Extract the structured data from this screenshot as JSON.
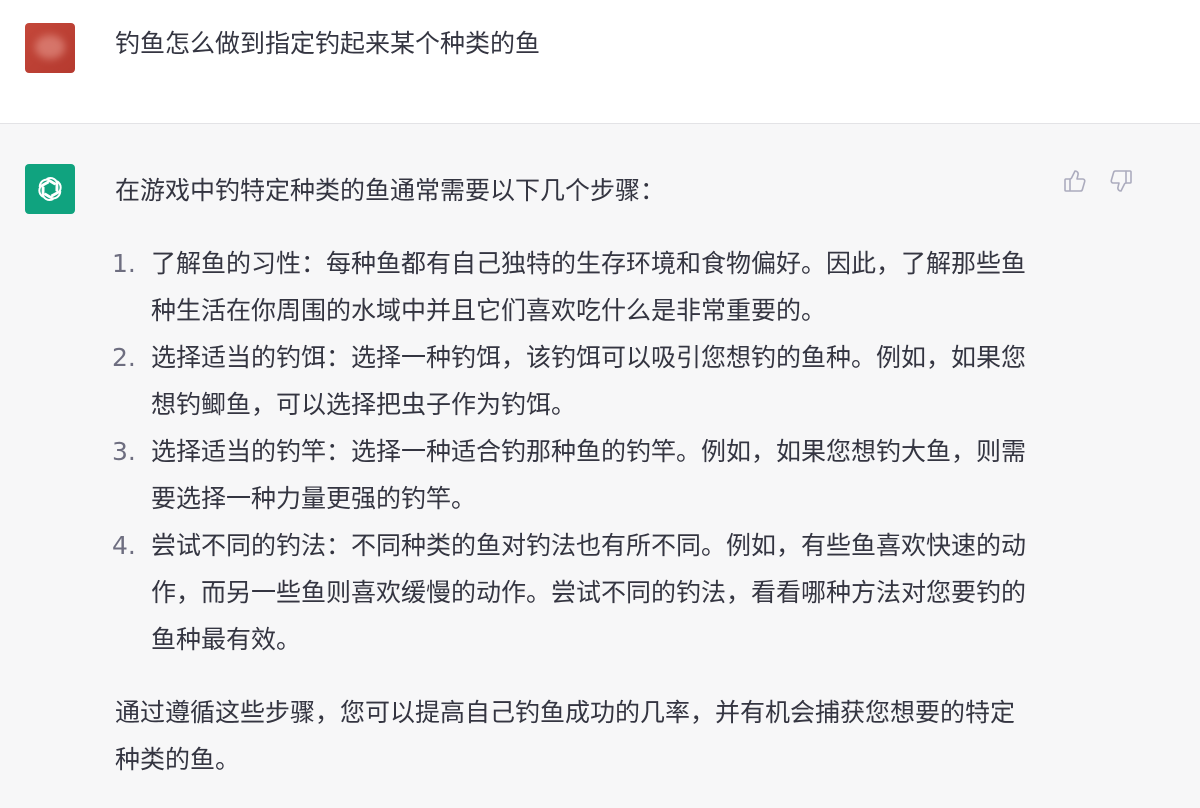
{
  "user_message": {
    "text": "钓鱼怎么做到指定钓起来某个种类的鱼"
  },
  "assistant_message": {
    "intro": "在游戏中钓特定种类的鱼通常需要以下几个步骤：",
    "steps": [
      {
        "number": "1.",
        "text": "了解鱼的习性：每种鱼都有自己独特的生存环境和食物偏好。因此，了解那些鱼种生活在你周围的水域中并且它们喜欢吃什么是非常重要的。"
      },
      {
        "number": "2.",
        "text": "选择适当的钓饵：选择一种钓饵，该钓饵可以吸引您想钓的鱼种。例如，如果您想钓鲫鱼，可以选择把虫子作为钓饵。"
      },
      {
        "number": "3.",
        "text": "选择适当的钓竿：选择一种适合钓那种鱼的钓竿。例如，如果您想钓大鱼，则需要选择一种力量更强的钓竿。"
      },
      {
        "number": "4.",
        "text": "尝试不同的钓法：不同种类的鱼对钓法也有所不同。例如，有些鱼喜欢快速的动作，而另一些鱼则喜欢缓慢的动作。尝试不同的钓法，看看哪种方法对您要钓的鱼种最有效。"
      }
    ],
    "conclusion": "通过遵循这些步骤，您可以提高自己钓鱼成功的几率，并有机会捕获您想要的特定种类的鱼。"
  },
  "icons": {
    "assistant_avatar": "openai-logo-icon",
    "thumbs_up": "thumbs-up-icon",
    "thumbs_down": "thumbs-down-icon"
  },
  "colors": {
    "user_avatar": "#b53a2f",
    "assistant_avatar": "#10a37f",
    "assistant_bg": "#f7f7f8",
    "text": "#343541"
  }
}
